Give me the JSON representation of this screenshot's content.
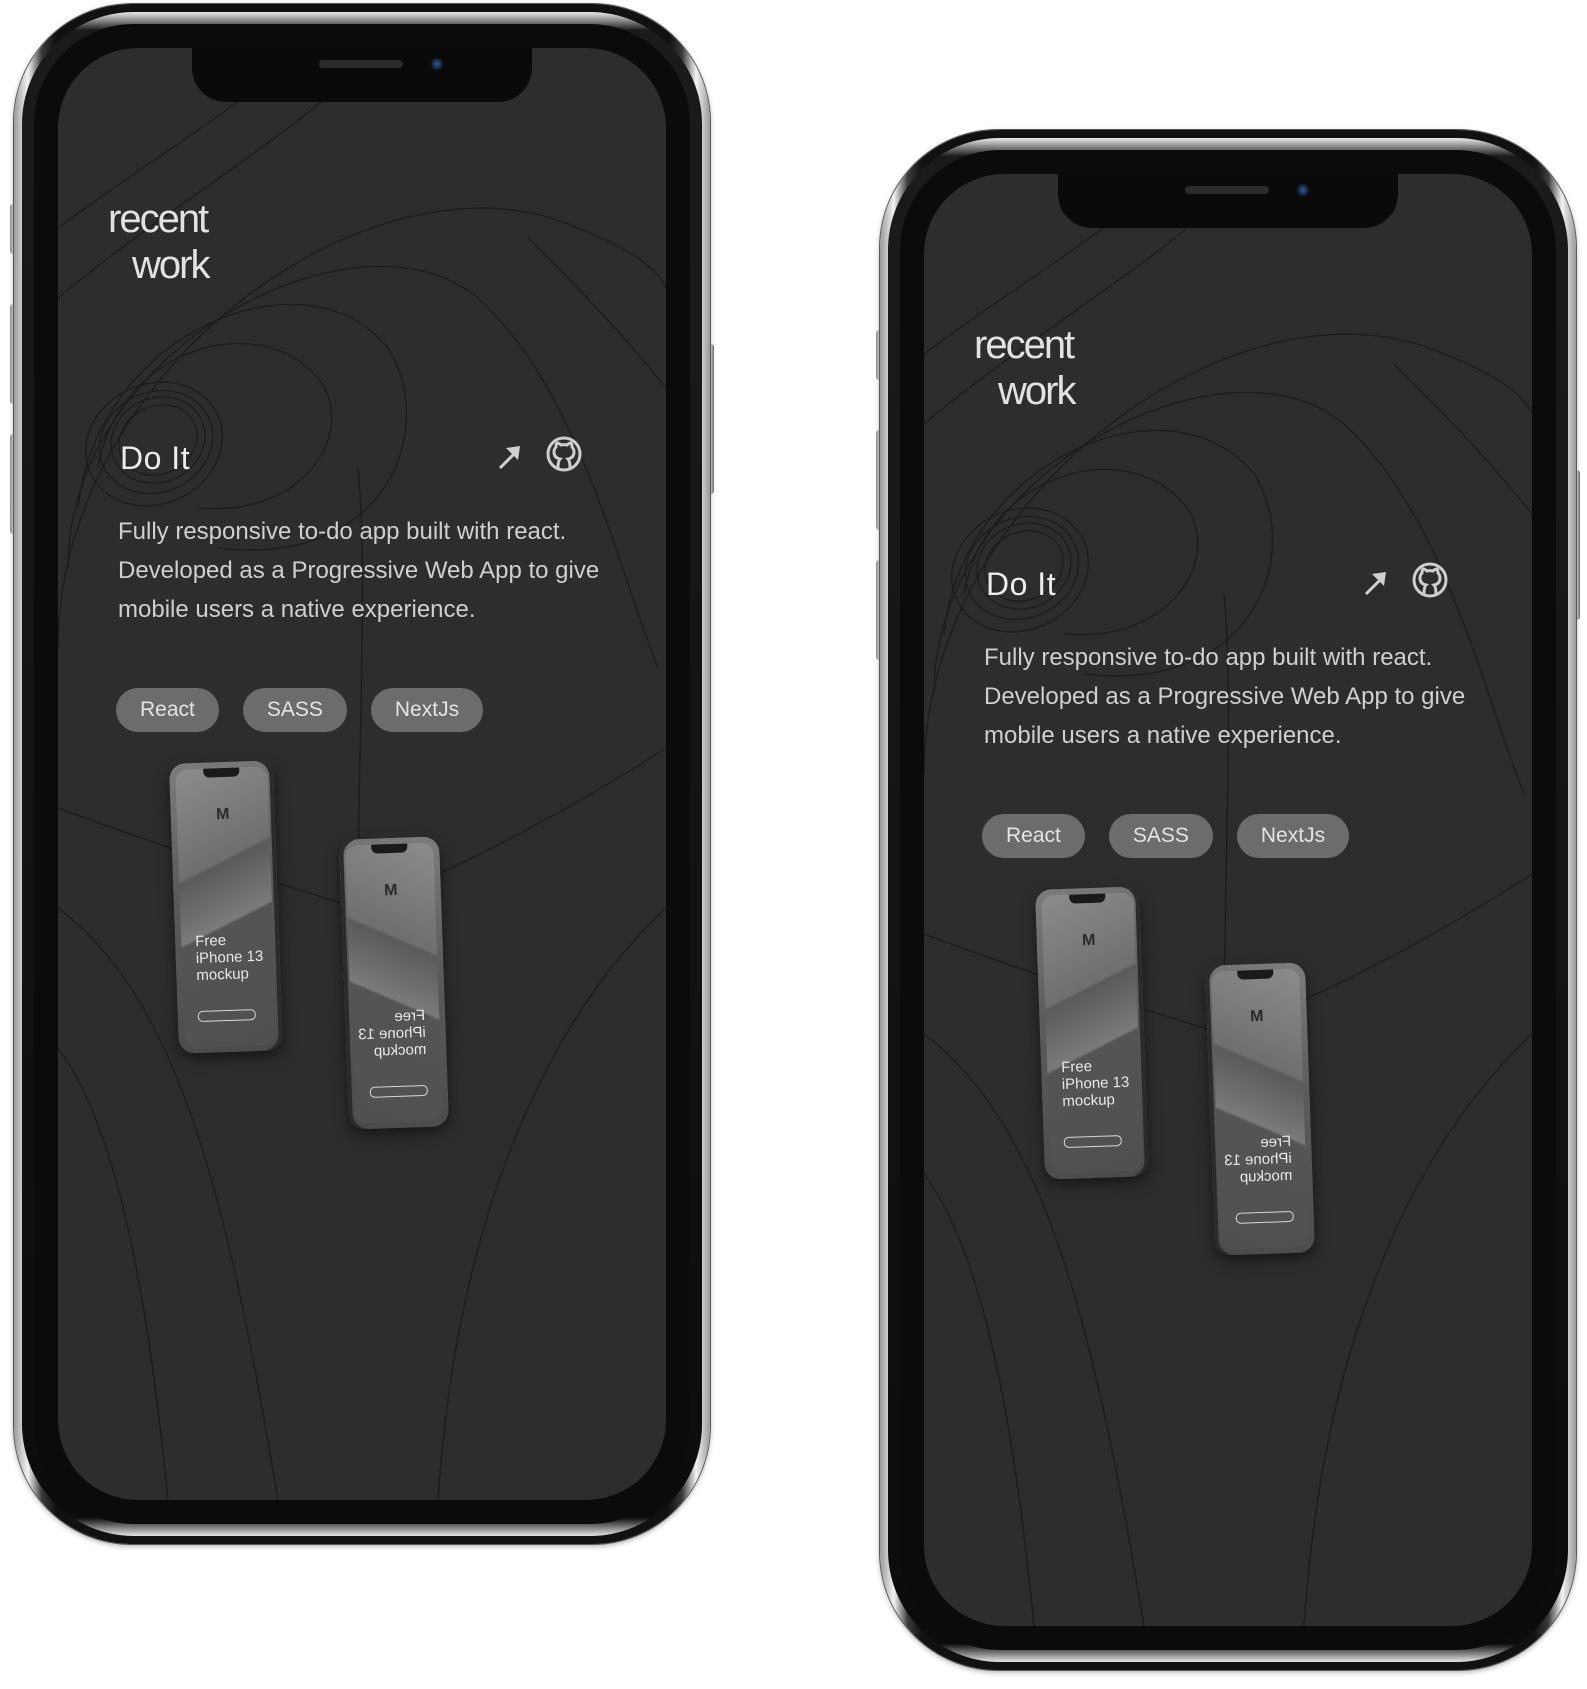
{
  "phones": [
    {
      "section_title_line1": "recent",
      "section_title_line2": "work",
      "project": {
        "title": "Do It",
        "description": "Fully responsive to-do app built with react. Developed as a Progressive Web App to give mobile users a native experience.",
        "tags": [
          "React",
          "SASS",
          "NextJs"
        ]
      },
      "mockup_text": [
        "Free",
        "iPhone 13",
        "mockup"
      ],
      "mockup_logo": "M"
    },
    {
      "section_title_line1": "recent",
      "section_title_line2": "work",
      "project": {
        "title": "Do It",
        "description": "Fully responsive to-do app built with react. Developed as a Progressive Web App to give mobile users a native experience.",
        "tags": [
          "React",
          "SASS",
          "NextJs"
        ]
      },
      "mockup_text": [
        "Free",
        "iPhone 13",
        "mockup"
      ],
      "mockup_logo": "M"
    }
  ],
  "icons": {
    "link": "arrow-up-right-icon",
    "source": "github-icon"
  },
  "colors": {
    "screen_background": "#2d2d2e",
    "tag_background": "#6c6c6c",
    "text": "#e2e2e2"
  }
}
